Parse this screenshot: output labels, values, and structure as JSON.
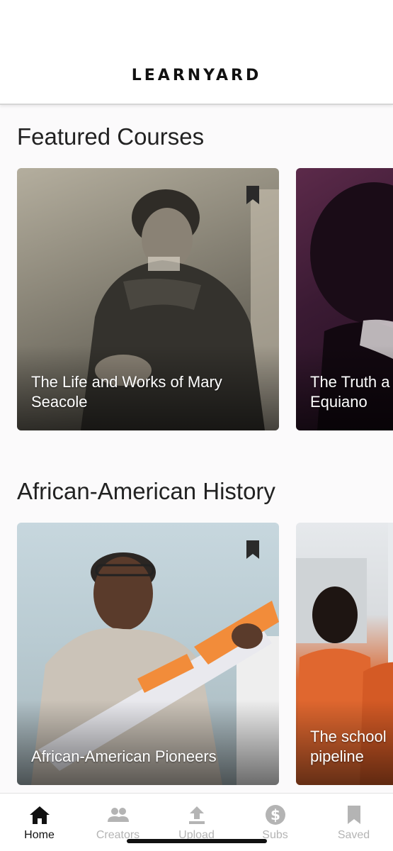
{
  "header": {
    "logo": "LEARNYARD"
  },
  "sections": [
    {
      "title": "Featured Courses",
      "cards": [
        {
          "title": "The Life and Works of Mary Seacole"
        },
        {
          "title_line1": "The Truth a",
          "title_line2": "Equiano"
        }
      ]
    },
    {
      "title": "African-American History",
      "cards": [
        {
          "title": "African-American Pioneers"
        },
        {
          "title_line1": "The school",
          "title_line2": "pipeline"
        }
      ]
    }
  ],
  "tabs": [
    {
      "label": "Home",
      "icon": "home-icon",
      "active": true
    },
    {
      "label": "Creators",
      "icon": "people-icon",
      "active": false
    },
    {
      "label": "Upload",
      "icon": "upload-icon",
      "active": false
    },
    {
      "label": "Subs",
      "icon": "dollar-icon",
      "active": false
    },
    {
      "label": "Saved",
      "icon": "bookmark-icon",
      "active": false
    }
  ],
  "colors": {
    "active_tab": "#111111",
    "inactive_tab": "#b4b4b4",
    "background": "#fbfafb"
  }
}
